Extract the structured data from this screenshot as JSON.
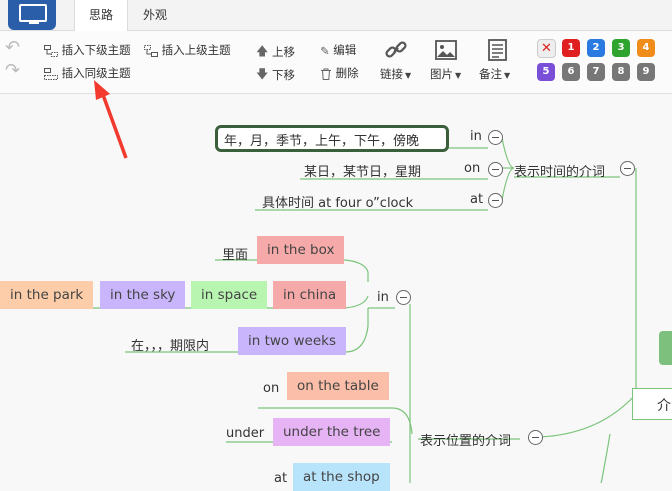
{
  "tabs": [
    "思路",
    "外观"
  ],
  "toolbar": {
    "insert_child": "插入下级主题",
    "insert_parent": "插入上级主题",
    "insert_sibling": "插入同级主题",
    "move_up": "上移",
    "move_down": "下移",
    "edit": "编辑",
    "delete": "删除",
    "link": "链接",
    "image": "图片",
    "note": "备注",
    "priorities": [
      "1",
      "2",
      "3",
      "4",
      "5",
      "6",
      "7",
      "8",
      "9"
    ],
    "priority_colors": [
      "#e02020",
      "#2a7ae2",
      "#2ea32e",
      "#f08c1a",
      "#7a4fd8",
      "#777777",
      "#777777",
      "#777777",
      "#777777"
    ]
  },
  "mindmap": {
    "root_partial": "介",
    "time": {
      "label": "表示时间的介词",
      "items": [
        {
          "text": "年，月，季节，上午，下午，傍晚",
          "prep": "in"
        },
        {
          "text": "某日，某节日，星期",
          "prep": "on"
        },
        {
          "text": "具体时间  at four o”clock",
          "prep": "at"
        }
      ]
    },
    "place": {
      "label": "表示位置的介词",
      "in_label": "in",
      "limian": "里面",
      "in_the_box": "in the box",
      "in_the_park": "in the park",
      "in_the_sky": "in the sky",
      "in_space": "in space",
      "in_china": "in china",
      "zai": "在，，，期限内",
      "in_two_weeks": "in two weeks",
      "on_label": "on",
      "on_the_table": "on the table",
      "under_label": "under",
      "under_the_tree": "under the tree",
      "at_label": "at",
      "at_the_shop": "at the shop"
    }
  }
}
